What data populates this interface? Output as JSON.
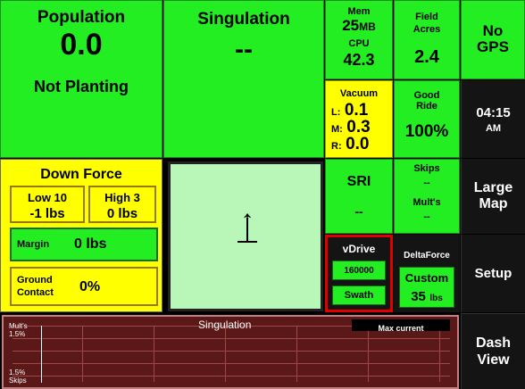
{
  "population": {
    "title": "Population",
    "value": "0.0",
    "status": "Not Planting"
  },
  "singulation_tile": {
    "title": "Singulation",
    "value": "--"
  },
  "memory": {
    "mem_label": "Mem",
    "mem_value": "25",
    "mem_unit": "MB",
    "cpu_label": "CPU",
    "cpu_value": "42.3"
  },
  "field_acres": {
    "label_line1": "Field",
    "label_line2": "Acres",
    "value": "2.4"
  },
  "gps": {
    "line1": "No",
    "line2": "GPS"
  },
  "vacuum": {
    "title": "Vacuum",
    "l_label": "L:",
    "l_value": "0.1",
    "m_label": "M:",
    "m_value": "0.3",
    "r_label": "R:",
    "r_value": "0.0"
  },
  "good_ride": {
    "label_line1": "Good",
    "label_line2": "Ride",
    "value": "100%"
  },
  "clock": {
    "time": "04:15",
    "ampm": "AM"
  },
  "down_force": {
    "title": "Down Force",
    "low_label": "Low 10",
    "low_value": "-1 lbs",
    "high_label": "High 3",
    "high_value": "0 lbs",
    "margin_label": "Margin",
    "margin_value": "0 lbs",
    "ground_label_line1": "Ground",
    "ground_label_line2": "Contact",
    "ground_value": "0%"
  },
  "map_view": {
    "north_arrow": "↑"
  },
  "sri": {
    "title": "SRI",
    "value": "--"
  },
  "skips": {
    "label": "Skips",
    "value": "--",
    "mults_label": "Mult's",
    "mults_value": "--"
  },
  "large_map": {
    "line1": "Large",
    "line2": "Map"
  },
  "vdrive": {
    "title": "vDrive",
    "rate": "160000",
    "mode": "Swath"
  },
  "deltaforce": {
    "title": "DeltaForce",
    "mode": "Custom",
    "value": "35",
    "unit": "lbs"
  },
  "setup": {
    "label": "Setup"
  },
  "graph": {
    "title": "Singulation",
    "badge": "Max current",
    "top_label_line1": "Mult's",
    "top_label_line2": "1.5%",
    "bottom_label_line1": "1.5%",
    "bottom_label_line2": "Skips"
  },
  "dash_view": {
    "line1": "Dash",
    "line2": "View"
  },
  "colors": {
    "green": "#22ee22",
    "yellow": "#ffff00",
    "map_bg": "#b8f7b8",
    "graph_bg": "#5a1818",
    "highlight": "#e00000"
  }
}
